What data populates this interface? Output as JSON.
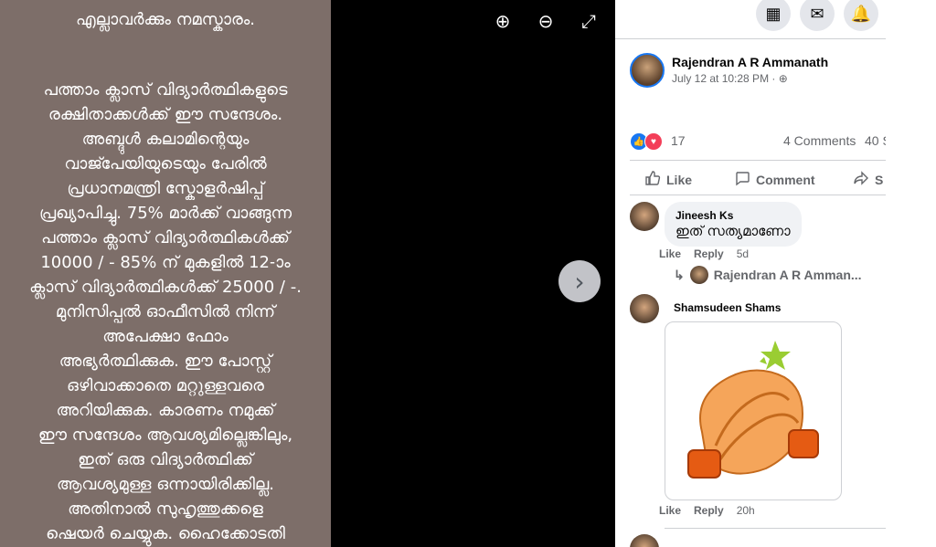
{
  "viewer": {
    "photo_text": {
      "greeting": "എല്ലാവർക്കും നമസ്കാരം.",
      "lines": [
        "പത്താം ക്ലാസ് വിദ്യാർത്ഥികളുടെ",
        "രക്ഷിതാക്കൾക്ക് ഈ സന്ദേശം.",
        "അബ്ദുൾ കലാമിന്റെയും",
        "വാജ്പേയിയുടെയും പേരിൽ",
        "പ്രധാനമന്ത്രി സ്കോളർഷിപ്പ്",
        "പ്രഖ്യാപിച്ചു. 75% മാർക്ക് വാങ്ങുന്ന",
        "പത്താം ക്ലാസ് വിദ്യാർത്ഥികൾക്ക്",
        "10000 / - 85% ന് മുകളിൽ 12-ാം",
        "ക്ലാസ് വിദ്യാർത്ഥികൾക്ക് 25000 / -.",
        "മുനിസിപ്പൽ ഓഫീസിൽ നിന്ന്",
        "അപേക്ഷാ ഫോം",
        "അഭ്യർത്ഥിക്കുക. ഈ പോസ്റ്റ്",
        "ഒഴിവാക്കാതെ മറ്റുള്ളവരെ",
        "അറിയിക്കുക. കാരണം നമുക്ക്",
        "ഈ സന്ദേശം ആവശ്യമില്ലെങ്കിലും,",
        "ഇത് ഒരു വിദ്യാർത്ഥിക്ക്",
        "ആവശ്യമുള്ള ഒന്നായിരിക്കില്ല.",
        "അതിനാൽ സുഹൃത്തുക്കളെ",
        "ഷെയർ ചെയ്യുക. ഹൈക്കോടതി"
      ]
    },
    "controls": {
      "zoom_in": "⊕",
      "zoom_out": "⊖",
      "fullscreen": "⤢",
      "next": "›"
    }
  },
  "topbar": {
    "menu_icon": "▦",
    "messenger_icon": "✉",
    "notifications_icon": "🔔"
  },
  "post": {
    "author": "Rajendran A R Ammanath",
    "meta": "July 12 at 10:28 PM · ",
    "globe": "⊕",
    "reaction_count": "17",
    "comments": "4 Comments",
    "shares": "40 S",
    "like_label": "Like",
    "comment_label": "Comment",
    "share_label": "S"
  },
  "comments": [
    {
      "name": "Jineesh Ks",
      "text": "ഇത് സത്യമാണോ",
      "like": "Like",
      "reply": "Reply",
      "time": "5d",
      "reply_author": "Rajendran A R Amman..."
    },
    {
      "name": "Shamsudeen Shams",
      "like": "Like",
      "reply": "Reply",
      "time": "20h"
    }
  ]
}
